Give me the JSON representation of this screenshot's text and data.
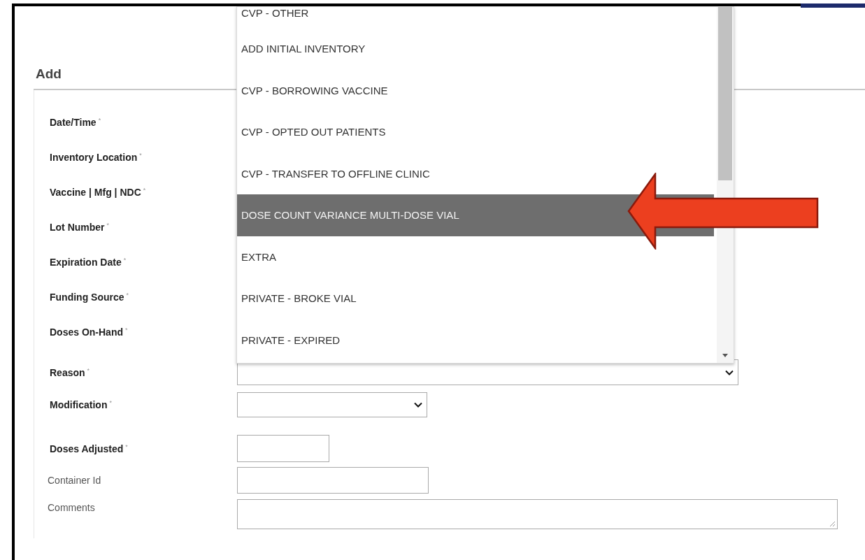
{
  "heading": "Add",
  "fields": [
    {
      "label": "Date/Time",
      "mark": "*",
      "required": true,
      "kind": "covered"
    },
    {
      "label": "Inventory Location",
      "mark": "*",
      "required": true,
      "kind": "covered"
    },
    {
      "label": "Vaccine | Mfg | NDC",
      "mark": "*",
      "required": true,
      "kind": "covered"
    },
    {
      "label": "Lot Number",
      "mark": "*",
      "required": true,
      "kind": "covered"
    },
    {
      "label": "Expiration Date",
      "mark": "*",
      "required": true,
      "kind": "covered"
    },
    {
      "label": "Funding Source",
      "mark": "*",
      "required": true,
      "kind": "covered"
    },
    {
      "label": "Doses On-Hand",
      "mark": "*",
      "required": true,
      "kind": "covered"
    },
    {
      "label": "Reason",
      "mark": "*",
      "required": true,
      "kind": "select"
    },
    {
      "label": "Modification",
      "mark": "*",
      "required": true,
      "kind": "compact-select"
    },
    {
      "label": "Doses Adjusted",
      "mark": "*",
      "required": true,
      "kind": "number-input"
    },
    {
      "label": "Container Id",
      "required": false,
      "kind": "text-input"
    },
    {
      "label": "Comments",
      "required": false,
      "kind": "textarea"
    }
  ],
  "dropdown": {
    "options": [
      {
        "label": "CVP - OTHER",
        "selected": false
      },
      {
        "label": "ADD INITIAL INVENTORY",
        "selected": false
      },
      {
        "label": "CVP - BORROWING VACCINE",
        "selected": false
      },
      {
        "label": "CVP - OPTED OUT PATIENTS",
        "selected": false
      },
      {
        "label": "CVP - TRANSFER TO OFFLINE CLINIC",
        "selected": false
      },
      {
        "label": "DOSE COUNT VARIANCE MULTI-DOSE VIAL",
        "selected": true
      },
      {
        "label": "EXTRA",
        "selected": false
      },
      {
        "label": "PRIVATE - BROKE VIAL",
        "selected": false
      },
      {
        "label": "PRIVATE - EXPIRED",
        "selected": false
      }
    ]
  }
}
